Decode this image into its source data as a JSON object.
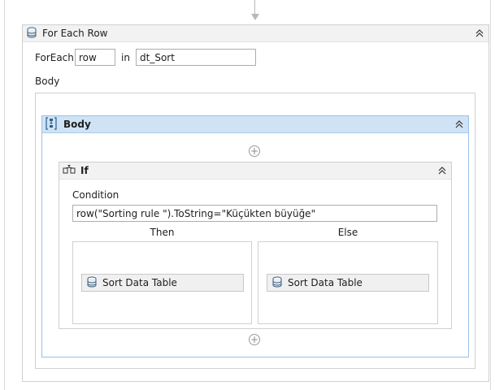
{
  "foreach": {
    "title": "For Each Row",
    "foreach_label": "ForEach",
    "item_value": "row",
    "in_label": "in",
    "collection_value": "dt_Sort",
    "body_label": "Body"
  },
  "body_sequence": {
    "title": "Body"
  },
  "if_activity": {
    "title": "If",
    "condition_label": "Condition",
    "condition_value": "row(\"Sorting rule \").ToString=\"Küçükten büyüğe\"",
    "then_label": "Then",
    "else_label": "Else",
    "then_activity": "Sort Data Table",
    "else_activity": "Sort Data Table"
  },
  "icons": {
    "add": "+",
    "collapse": "chevron-double-up"
  }
}
